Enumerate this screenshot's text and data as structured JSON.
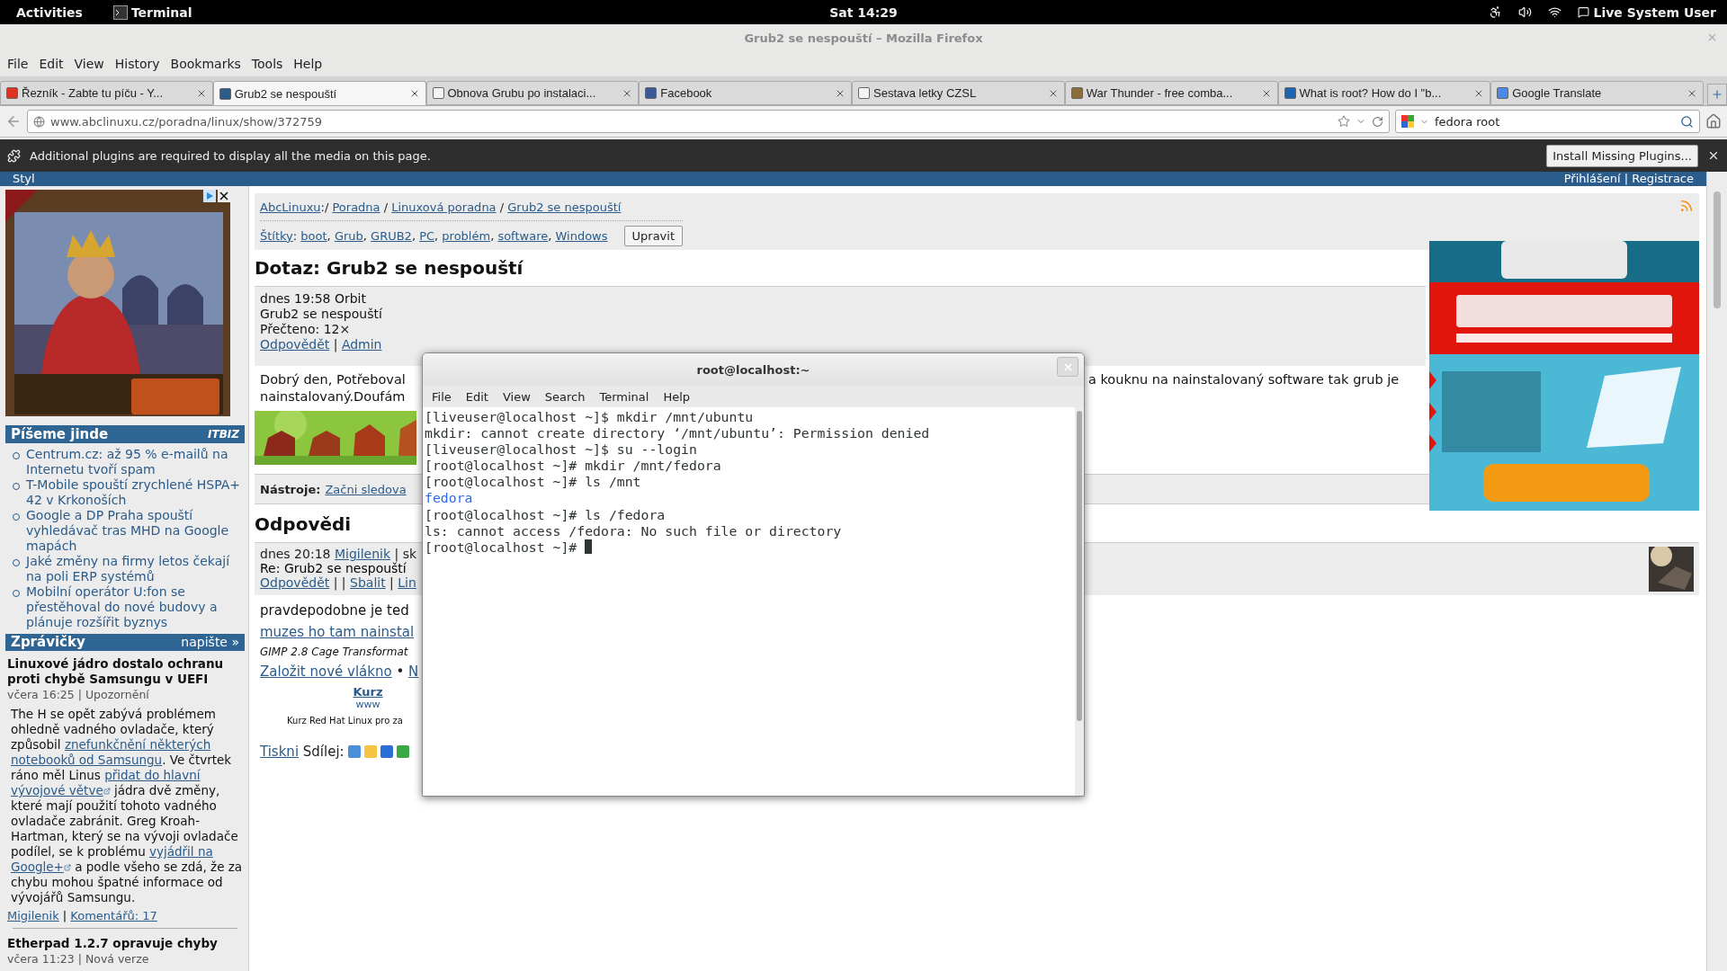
{
  "top_bar": {
    "activities": "Activities",
    "app": "Terminal",
    "clock": "Sat 14:29",
    "user": "Live System User"
  },
  "window": {
    "title": "Grub2 se nespouští – Mozilla Firefox"
  },
  "menu": [
    "File",
    "Edit",
    "View",
    "History",
    "Bookmarks",
    "Tools",
    "Help"
  ],
  "tabs": [
    {
      "label": "Řezník - Zabte tu píču - Y...",
      "selected": false
    },
    {
      "label": "Grub2 se nespouští",
      "selected": true
    },
    {
      "label": "Obnova Grubu po instalaci...",
      "selected": false
    },
    {
      "label": "Facebook",
      "selected": false
    },
    {
      "label": "Sestava letky CZSL",
      "selected": false
    },
    {
      "label": "War Thunder - free comba...",
      "selected": false
    },
    {
      "label": "What is root? How do I \"b...",
      "selected": false
    },
    {
      "label": "Google Translate",
      "selected": false
    }
  ],
  "url": "www.abclinuxu.cz/poradna/linux/show/372759",
  "search": {
    "value": "fedora root"
  },
  "notification": {
    "message": "Additional plugins are required to display all the media on this page.",
    "button": "Install Missing Plugins..."
  },
  "page": {
    "header": {
      "left": "Styl",
      "links": [
        {
          "t": "Přihlášení",
          "link": true
        },
        {
          "t": " | "
        },
        {
          "t": "Registrace",
          "link": true
        }
      ]
    },
    "sidebar": {
      "elsewhere": {
        "title": "Píšeme jinde",
        "logo": "ITBIZ",
        "items": [
          "Centrum.cz: až 95 % e-mailů na Internetu tvoří spam",
          "T-Mobile spouští zrychlené HSPA+ 42 v Krkonoších",
          "Google a DP Praha spouští vyhledávač tras MHD na Google mapách",
          "Jaké změny na firmy letos čekají na poli ERP systémů",
          "Mobilní operátor U:fon se přestěhoval do nové budovy a plánuje rozšířit byznys"
        ]
      },
      "news": {
        "title": "Zprávičky",
        "action": "napište »",
        "items": [
          {
            "headline": "Linuxové jádro dostalo ochranu proti chybě Samsungu v UEFI",
            "meta": "včera 16:25 | Upozornění",
            "body": [
              {
                "t": "The H se opět zabývá problémem ohledně vadného ovladače, který způsobil "
              },
              {
                "t": "znefunkčnění některých",
                "link": true
              },
              {
                "t": "notebooků od Samsungu",
                "link": true
              },
              {
                "t": ". Ve čtvrtek ráno měl Linus "
              },
              {
                "t": "přidat do hlavní",
                "link": true
              },
              {
                "t": "vývojové větve",
                "link": true,
                "ext": true
              },
              {
                "t": " jádra dvě změny, které mají použití tohoto vadného ovladače zabránit. Greg Kroah-Hartman, který se na vývoji ovladače podílel, se k problému "
              },
              {
                "t": "vyjádřil na",
                "link": true
              },
              {
                "t": "Google+",
                "link": true,
                "ext": true
              },
              {
                "t": " a podle všeho se zdá, že za chybu mohou špatné informace od vývojářů Samsungu."
              }
            ],
            "footer": [
              {
                "t": "Migilenik",
                "link": true
              },
              {
                "t": " | "
              },
              {
                "t": "Komentářů: 17",
                "link": true
              }
            ]
          },
          {
            "headline": "Etherpad 1.2.7 opravuje chyby",
            "meta": "včera 11:23 | Nová verze"
          }
        ]
      }
    },
    "breadcrumb": [
      {
        "t": "AbcLinuxu",
        "link": true
      },
      {
        "t": ":/ "
      },
      {
        "t": "Poradna",
        "link": true
      },
      {
        "t": " / "
      },
      {
        "t": "Linuxová poradna",
        "link": true
      },
      {
        "t": " / "
      },
      {
        "t": "Grub2 se nespouští",
        "link": true
      }
    ],
    "tags": [
      {
        "t": "Štítky",
        "link": true
      },
      {
        "t": ": "
      },
      {
        "t": "boot",
        "link": true
      },
      {
        "t": ", "
      },
      {
        "t": "Grub",
        "link": true
      },
      {
        "t": ", "
      },
      {
        "t": "GRUB2",
        "link": true
      },
      {
        "t": ", "
      },
      {
        "t": "PC",
        "link": true
      },
      {
        "t": ", "
      },
      {
        "t": "problém",
        "link": true
      },
      {
        "t": ", "
      },
      {
        "t": "software",
        "link": true
      },
      {
        "t": ", "
      },
      {
        "t": "Windows",
        "link": true
      }
    ],
    "edit_button": "Upravit",
    "question": {
      "heading": "Dotaz: Grub2 se nespouští",
      "info": [
        "dnes 19:58 Orbit",
        "Grub2 se nespouští",
        "Přečteno: 12×"
      ],
      "actions": [
        {
          "t": "Odpovědět",
          "link": true
        },
        {
          "t": " | "
        },
        {
          "t": "Admin",
          "link": true
        }
      ],
      "body_left": [
        "Dobrý den, Potřeboval",
        "nainstalovaný.Doufám"
      ],
      "body_right": [
        "a kouknu na nainstalovaný software tak grub je"
      ]
    },
    "tools": {
      "label": "Nástroje:",
      "link": "Začni sledova"
    },
    "answers": {
      "heading": "Odpovědi",
      "meta": [
        {
          "t": "dnes 20:18 "
        },
        {
          "t": "Migilenik",
          "link": true
        },
        {
          "t": " | sk"
        }
      ],
      "subject": "Re: Grub2 se nespouští",
      "actions": [
        {
          "t": "Odpovědět",
          "link": true
        },
        {
          "t": " | | "
        },
        {
          "t": "Sbalit",
          "link": true
        },
        {
          "t": " | "
        },
        {
          "t": "Lin",
          "link": true
        }
      ],
      "text": "pravdepodobne je ted",
      "link": "muzes ho tam nainstal"
    },
    "promo": "GIMP 2.8 Cage Transformat",
    "thread_links": [
      {
        "t": "Založit nové vlákno",
        "link": true
      },
      {
        "t": " • "
      },
      {
        "t": "N",
        "link": true
      }
    ],
    "course": {
      "title": "Kurz",
      "url": "www",
      "text": "Kurz Red Hat Linux pro za"
    },
    "print": {
      "link": "Tiskni",
      "share": "Sdílej:"
    }
  },
  "terminal": {
    "title": "root@localhost:~",
    "menu": [
      "File",
      "Edit",
      "View",
      "Search",
      "Terminal",
      "Help"
    ],
    "cursor": true,
    "lines": [
      {
        "kind": "text",
        "text": "[liveuser@localhost ~]$ mkdir /mnt/ubuntu"
      },
      {
        "kind": "text",
        "text": "mkdir: cannot create directory ‘/mnt/ubuntu’: Permission denied"
      },
      {
        "kind": "text",
        "text": "[liveuser@localhost ~]$ su --login"
      },
      {
        "kind": "text",
        "text": "[root@localhost ~]# mkdir /mnt/fedora"
      },
      {
        "kind": "text",
        "text": "[root@localhost ~]# ls /mnt"
      },
      {
        "kind": "dir",
        "text": "fedora"
      },
      {
        "kind": "text",
        "text": "[root@localhost ~]# ls /fedora"
      },
      {
        "kind": "text",
        "text": "ls: cannot access /fedora: No such file or directory"
      },
      {
        "kind": "text",
        "text": "[root@localhost ~]# "
      }
    ]
  }
}
